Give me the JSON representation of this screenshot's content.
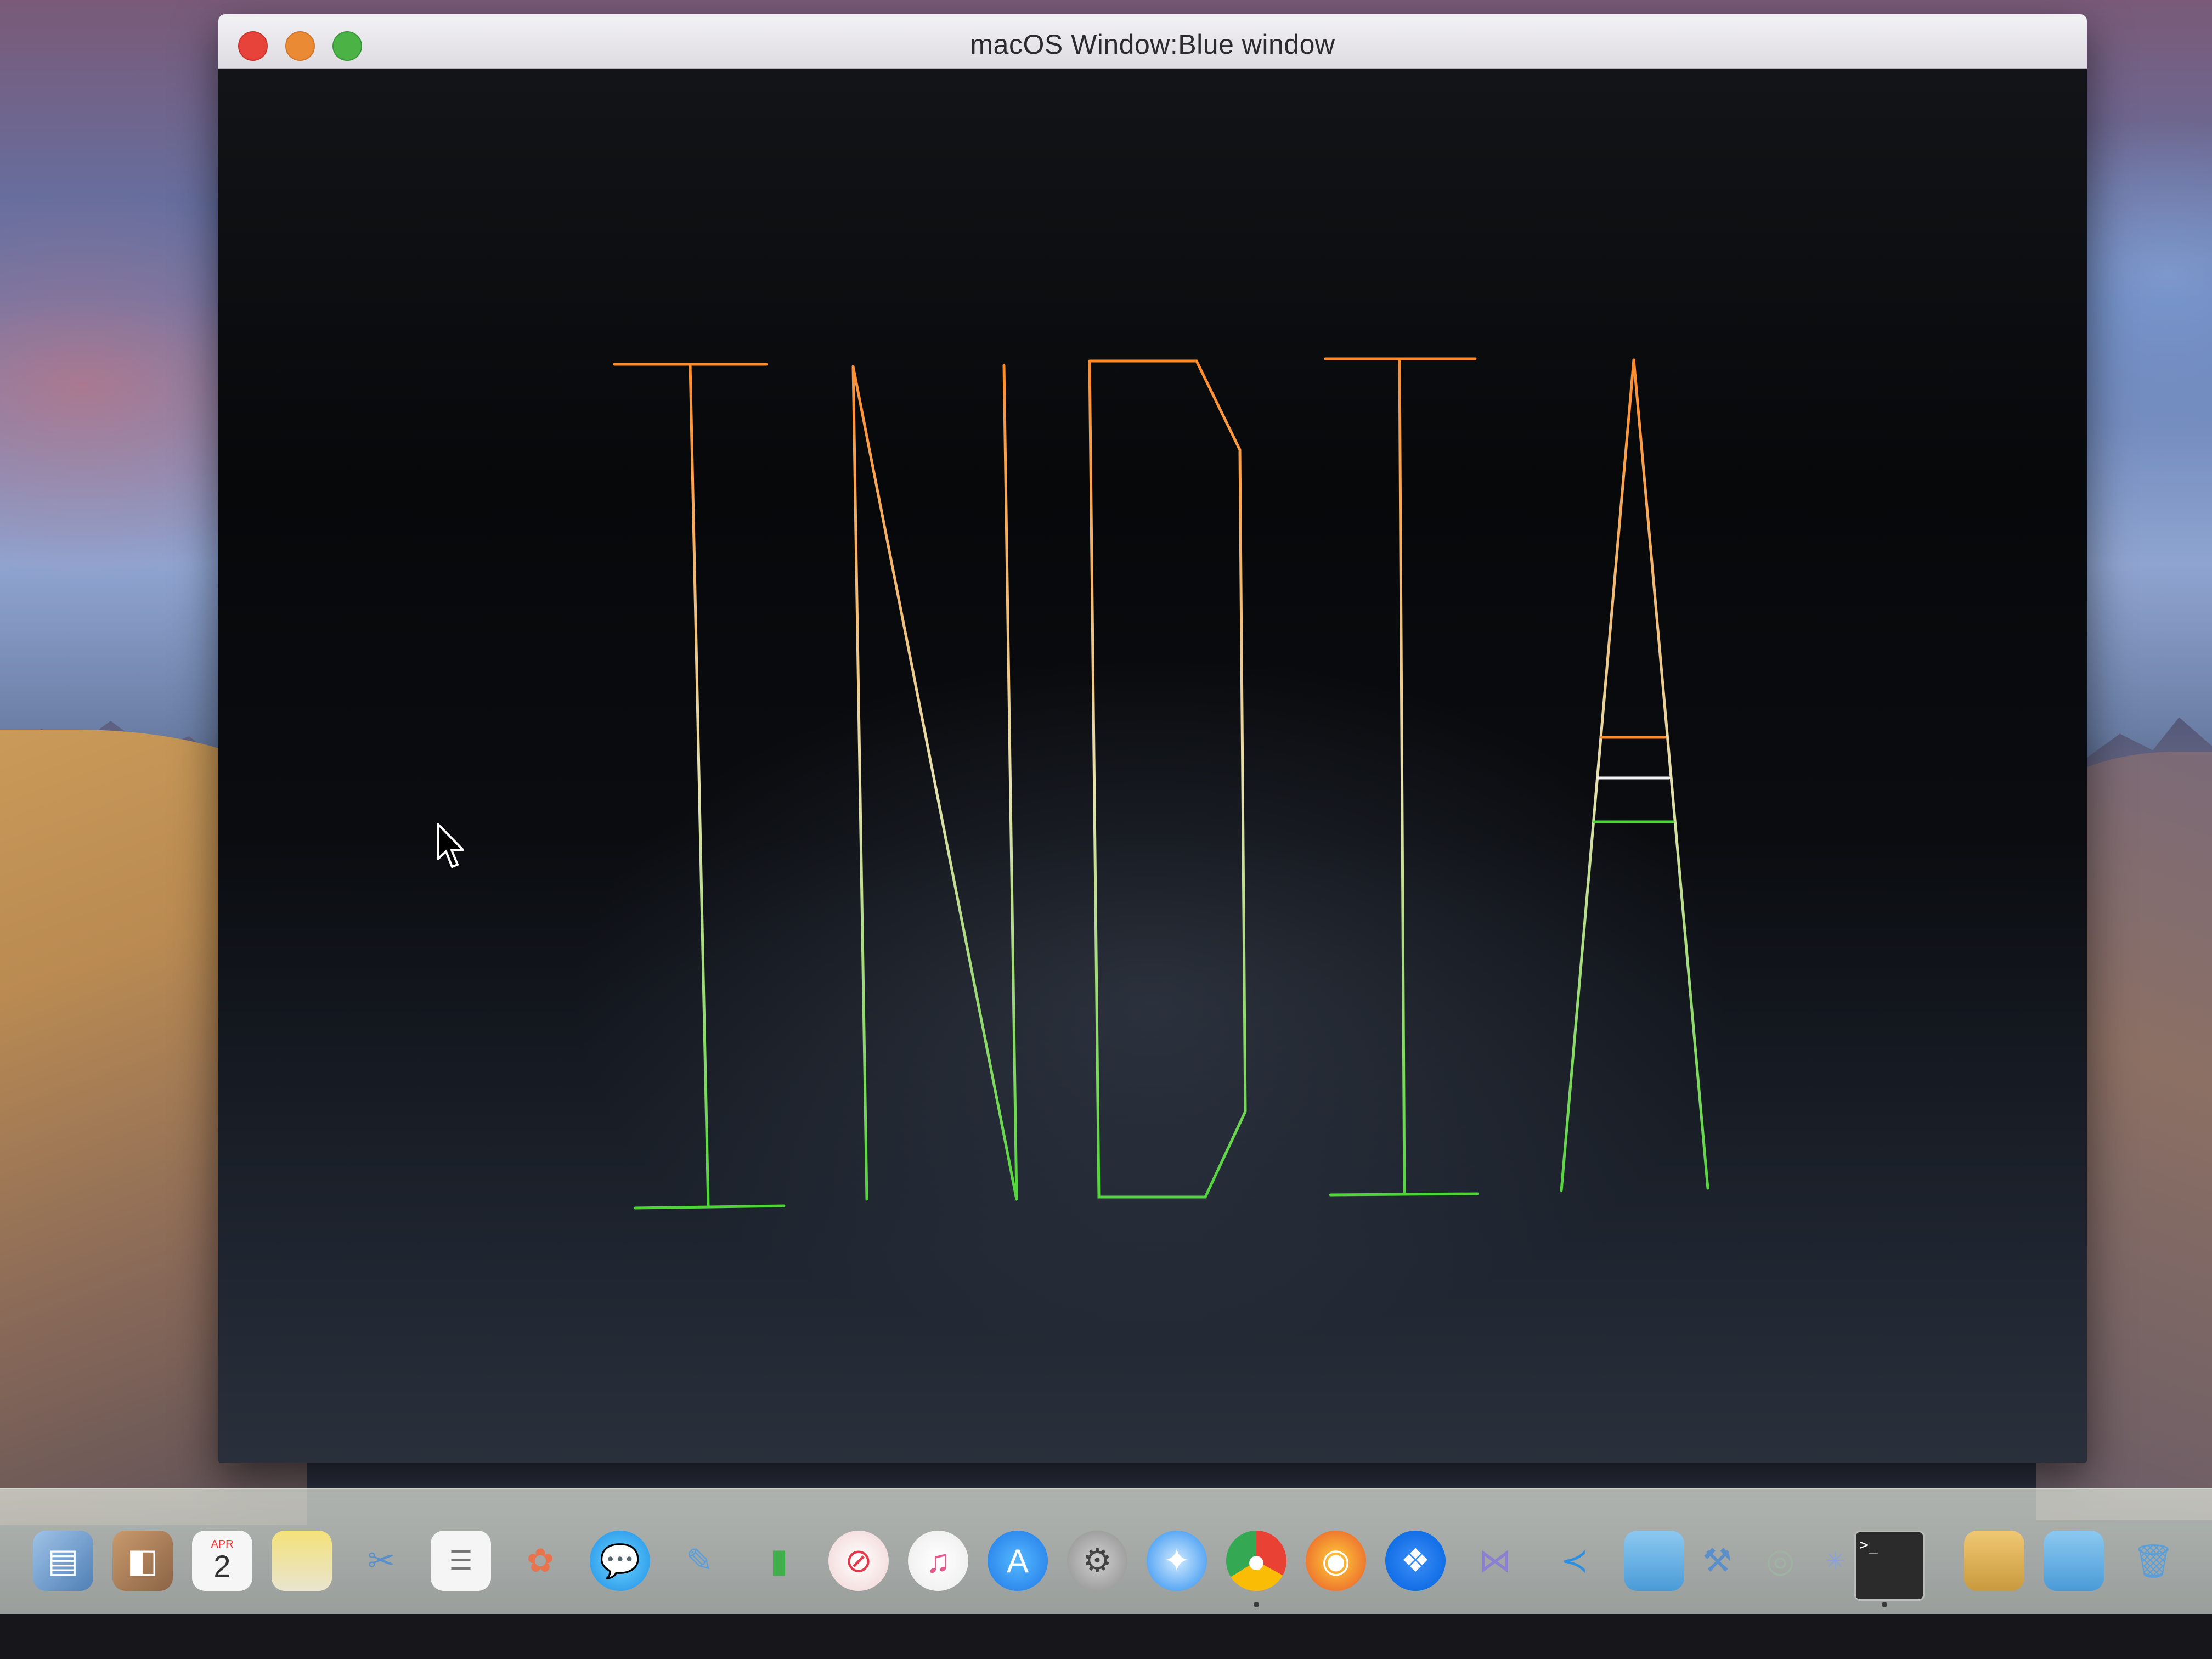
{
  "window": {
    "title": "macOS Window:Blue window"
  },
  "drawing": {
    "letters": [
      "I",
      "N",
      "D",
      "I",
      "A"
    ],
    "colors": {
      "saffron": "#ff8a2a",
      "white": "#f4f4f4",
      "green": "#4fd43a"
    }
  },
  "dock": {
    "icons": [
      "finder-preview-icon",
      "contacts-icon",
      "calendar-icon",
      "notes-icon",
      "scissors-utility-icon",
      "reminders-icon",
      "photos-icon",
      "messages-icon",
      "feedback-icon",
      "numbers-icon",
      "news-icon",
      "music-icon",
      "app-store-icon",
      "system-preferences-icon",
      "safari-icon",
      "chrome-icon",
      "firefox-icon",
      "dropbox-icon",
      "visual-studio-icon",
      "vscode-icon",
      "folder-icon",
      "xcode-icon",
      "instruments-icon",
      "spark-icon",
      "terminal-icon",
      "downloads-stack-icon",
      "folder-stack-icon",
      "trash-icon"
    ],
    "calendar": {
      "month": "APR",
      "day": "2"
    }
  }
}
